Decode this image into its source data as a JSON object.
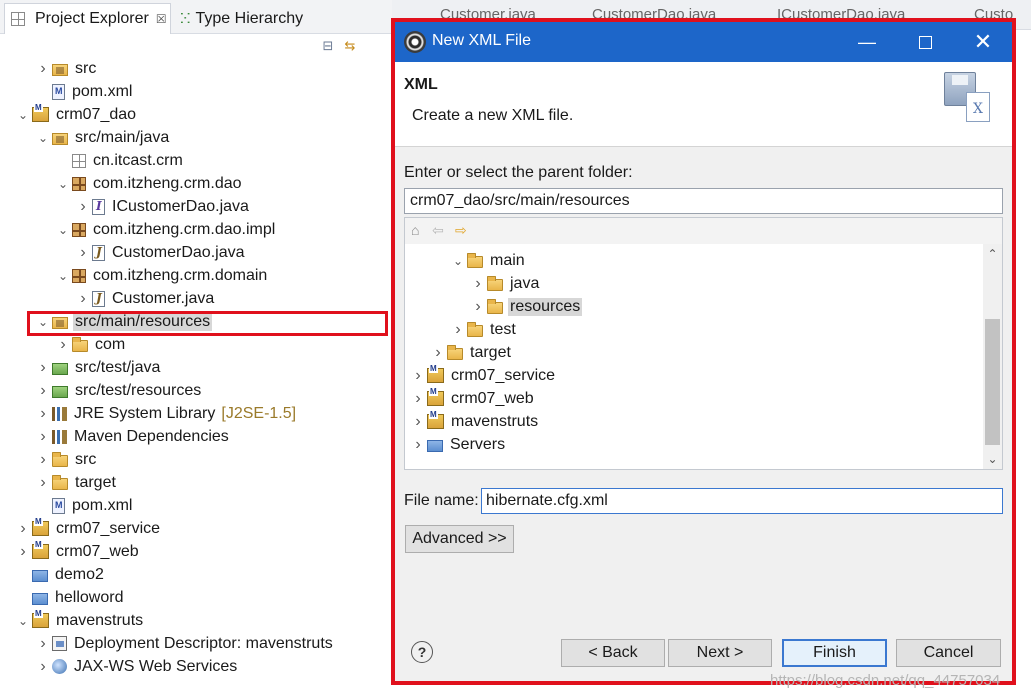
{
  "explorer": {
    "tabs": [
      {
        "label": "Project Explorer",
        "close": "☒"
      },
      {
        "label": "Type Hierarchy"
      }
    ],
    "items": [
      {
        "label": "src",
        "icon": "source-folder-icon"
      },
      {
        "label": "pom.xml",
        "icon": "xml-file-icon"
      },
      {
        "label": "crm07_dao",
        "icon": "maven-project-icon"
      },
      {
        "label": "src/main/java",
        "icon": "source-folder-icon"
      },
      {
        "label": "cn.itcast.crm",
        "icon": "empty-package-icon"
      },
      {
        "label": "com.itzheng.crm.dao",
        "icon": "package-icon"
      },
      {
        "label": "ICustomerDao.java",
        "icon": "java-interface-icon"
      },
      {
        "label": "com.itzheng.crm.dao.impl",
        "icon": "package-icon"
      },
      {
        "label": "CustomerDao.java",
        "icon": "java-file-icon"
      },
      {
        "label": "com.itzheng.crm.domain",
        "icon": "package-icon"
      },
      {
        "label": "Customer.java",
        "icon": "java-file-icon"
      },
      {
        "label": "src/main/resources",
        "icon": "source-folder-icon"
      },
      {
        "label": "com",
        "icon": "folder-icon"
      },
      {
        "label": "src/test/java",
        "icon": "source-folder-icon"
      },
      {
        "label": "src/test/resources",
        "icon": "source-folder-icon"
      },
      {
        "label": "JRE System Library",
        "decoration": "[J2SE-1.5]",
        "icon": "library-icon"
      },
      {
        "label": "Maven Dependencies",
        "icon": "library-icon"
      },
      {
        "label": "src",
        "icon": "folder-icon"
      },
      {
        "label": "target",
        "icon": "folder-icon"
      },
      {
        "label": "pom.xml",
        "icon": "xml-file-icon"
      },
      {
        "label": "crm07_service",
        "icon": "maven-project-icon"
      },
      {
        "label": "crm07_web",
        "icon": "maven-project-icon"
      },
      {
        "label": "demo2",
        "icon": "plain-folder-icon"
      },
      {
        "label": "helloword",
        "icon": "plain-folder-icon"
      },
      {
        "label": "mavenstruts",
        "icon": "maven-project-icon"
      },
      {
        "label": "Deployment Descriptor: mavenstruts",
        "icon": "deployment-descriptor-icon"
      },
      {
        "label": "JAX-WS Web Services",
        "icon": "web-services-icon"
      }
    ]
  },
  "editor_tabs": [
    "Customer.java",
    "CustomerDao.java",
    "ICustomerDao.java",
    "Custo"
  ],
  "dialog": {
    "title": "New XML File",
    "header_title": "XML",
    "header_desc": "Create a new XML file.",
    "parent_label": "Enter or select the parent folder:",
    "parent_value": "crm07_dao/src/main/resources",
    "folder_tree": [
      {
        "label": "main",
        "expanded": true
      },
      {
        "label": "java"
      },
      {
        "label": "resources",
        "selected": true
      },
      {
        "label": "test"
      },
      {
        "label": "target"
      },
      {
        "label": "crm07_service"
      },
      {
        "label": "crm07_web"
      },
      {
        "label": "mavenstruts"
      },
      {
        "label": "Servers"
      }
    ],
    "filename_label": "File name:",
    "filename_value": "hibernate.cfg.xml",
    "advanced_label": "Advanced >>",
    "help_label": "?",
    "back_label": "< Back",
    "next_label": "Next >",
    "finish_label": "Finish",
    "cancel_label": "Cancel"
  },
  "watermark": "https://blog.csdn.net/qq_44757034",
  "colors": {
    "titlebar": "#1d66c9",
    "highlight": "#e0101c"
  }
}
